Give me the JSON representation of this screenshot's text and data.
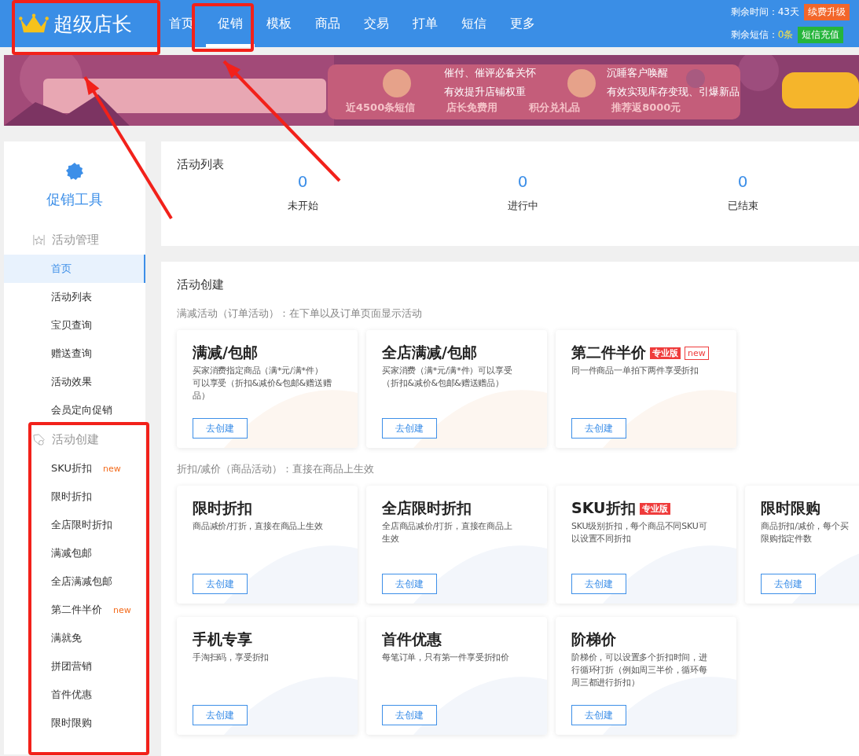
{
  "app": {
    "name": "超级店长"
  },
  "nav": [
    {
      "label": "首页",
      "selected": false
    },
    {
      "label": "促销",
      "selected": true
    },
    {
      "label": "模板",
      "selected": false
    },
    {
      "label": "商品",
      "selected": false
    },
    {
      "label": "交易",
      "selected": false
    },
    {
      "label": "打单",
      "selected": false
    },
    {
      "label": "短信",
      "selected": false
    },
    {
      "label": "更多",
      "selected": false
    }
  ],
  "account": {
    "time_label": "剩余时间：",
    "time_value": "43天",
    "renew_button": "续费升级",
    "sms_label": "剩余短信：",
    "sms_value": "0条",
    "recharge_button": "短信充值"
  },
  "banner": {
    "kind": "picture",
    "features": [
      {
        "lines": [
          "催付、催评必备关怀",
          "有效提升店铺权重"
        ]
      },
      {
        "lines": [
          "沉睡客户唤醒",
          "有效实现库存变现、引爆新品"
        ]
      }
    ],
    "perks": [
      "近4500条短信",
      "店长免费用",
      "积分兑礼品",
      "推荐返8000元"
    ]
  },
  "sidebar": {
    "title": "促销工具",
    "sections": [
      {
        "label": "活动管理",
        "kind": "manage",
        "items": [
          {
            "label": "首页",
            "selected": true
          },
          {
            "label": "活动列表",
            "selected": false
          },
          {
            "label": "宝贝查询",
            "selected": false
          },
          {
            "label": "赠送查询",
            "selected": false
          },
          {
            "label": "活动效果",
            "selected": false
          },
          {
            "label": "会员定向促销",
            "selected": false
          }
        ]
      },
      {
        "label": "活动创建",
        "kind": "create",
        "items": [
          {
            "label": "SKU折扣",
            "badge": "new",
            "selected": false
          },
          {
            "label": "限时折扣",
            "selected": false
          },
          {
            "label": "全店限时折扣",
            "selected": false
          },
          {
            "label": "满减包邮",
            "selected": false
          },
          {
            "label": "全店满减包邮",
            "selected": false
          },
          {
            "label": "第二件半价",
            "badge": "new",
            "selected": false
          },
          {
            "label": "满就免",
            "selected": false
          },
          {
            "label": "拼团营销",
            "selected": false
          },
          {
            "label": "首件优惠",
            "selected": false
          },
          {
            "label": "限时限购",
            "selected": false
          }
        ]
      }
    ]
  },
  "activity_list": {
    "title": "活动列表",
    "stats": [
      {
        "value": "0",
        "label": "未开始"
      },
      {
        "value": "0",
        "label": "进行中"
      },
      {
        "value": "0",
        "label": "已结束"
      }
    ]
  },
  "activity_create": {
    "title": "活动创建",
    "groups": [
      {
        "caption": "满减活动（订单活动）：在下单以及订单页面显示活动",
        "cards": [
          {
            "title": "满减/包邮",
            "desc_lines": [
              "买家消费指定商品（满*元/满*件）",
              "可以享受（折扣&减价&包邮&赠送赠",
              "品）"
            ],
            "button": "去创建"
          },
          {
            "title": "全店满减/包邮",
            "desc_lines": [
              "买家消费（满*元/满*件）可以享受",
              "（折扣&减价&包邮&赠送赠品）"
            ],
            "button": "去创建"
          },
          {
            "title": "第二件半价",
            "tags": [
              {
                "text": "专业版",
                "kind": "solid"
              },
              {
                "text": "new",
                "kind": "outline"
              }
            ],
            "desc_lines": [
              "同一件商品一单拍下两件享受折扣"
            ],
            "button": "去创建"
          }
        ]
      },
      {
        "caption": "折扣/减价（商品活动）：直接在商品上生效",
        "cards": [
          {
            "title": "限时折扣",
            "desc_lines": [
              "商品减价/打折，直接在商品上生效"
            ],
            "button": "去创建"
          },
          {
            "title": "全店限时折扣",
            "desc_lines": [
              "全店商品减价/打折，直接在商品上",
              "生效"
            ],
            "button": "去创建"
          },
          {
            "title": "SKU折扣",
            "tags": [
              {
                "text": "专业版",
                "kind": "solid"
              }
            ],
            "desc_lines": [
              "SKU级别折扣，每个商品不同SKU可",
              "以设置不同折扣"
            ],
            "button": "去创建"
          },
          {
            "title": "限时限购",
            "desc_lines": [
              "商品折扣/减价，每个买",
              "限购指定件数"
            ],
            "button": "去创建"
          },
          {
            "title": "手机专享",
            "desc_lines": [
              "手淘扫码，享受折扣"
            ],
            "button": "去创建"
          },
          {
            "title": "首件优惠",
            "desc_lines": [
              "每笔订单，只有第一件享受折扣价"
            ],
            "button": "去创建"
          },
          {
            "title": "阶梯价",
            "desc_lines": [
              "阶梯价，可以设置多个折扣时间，进",
              "行循环打折（例如周三半价，循环每",
              "周三都进行折扣）"
            ],
            "button": "去创建"
          }
        ]
      }
    ]
  }
}
